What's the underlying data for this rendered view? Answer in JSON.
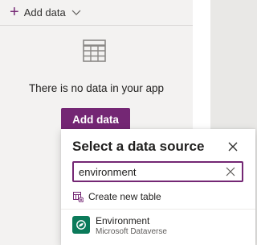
{
  "toolbar": {
    "add_data_label": "Add data",
    "icons": {
      "plus": "plus-icon",
      "chevron": "chevron-down-icon"
    }
  },
  "empty_state": {
    "icon": "table-grid-icon",
    "message": "There is no data in your app",
    "button_label": "Add data"
  },
  "data_source_panel": {
    "title": "Select a data source",
    "close_icon": "close-icon",
    "search": {
      "value": "environment",
      "clear_icon": "clear-icon"
    },
    "create_new_table_label": "Create new table",
    "results": [
      {
        "title": "Environment",
        "subtitle": "Microsoft Dataverse",
        "icon": "dataverse-icon"
      }
    ]
  },
  "colors": {
    "accent": "#742774",
    "canvas": "#f3f2f1",
    "dataverse": "#0b7a5a"
  }
}
